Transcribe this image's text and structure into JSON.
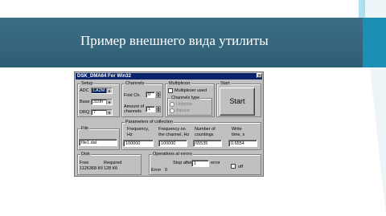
{
  "slide": {
    "title": "Пример внешнего вида утилиты"
  },
  "window": {
    "title": "DSK_DMA64 For Win32",
    "close_glyph": "×"
  },
  "setup": {
    "group_label": "Setup",
    "adc_label": "ADC",
    "adc_value": "LA2M",
    "base_label": "Base",
    "base_value": "310h",
    "drq_label": "DRQ",
    "drq_value": "7"
  },
  "channels": {
    "group_label": "Channels",
    "first_ch_label": "First Ch.",
    "first_ch_value": "0",
    "amount_label_1": "Amount of",
    "amount_label_2": "channels",
    "amount_value": "1"
  },
  "multiplexer": {
    "group_label": "Multiplexer",
    "used_label": "Multiplexer used",
    "channels_type_label": "Channels type",
    "option_1": "Unipolar",
    "option_2": "Bipolar"
  },
  "start": {
    "group_label": "Start",
    "button_label": "Start"
  },
  "file": {
    "group_label": "File",
    "value": "file1.dat"
  },
  "params": {
    "group_label": "Parameters of collection",
    "freq_label_1": "Frequency,",
    "freq_label_2": "Hz",
    "freq_value": "100000",
    "freq_ch_label_1": "Frequency on",
    "freq_ch_label_2": "the channel, Hz",
    "freq_ch_value": "100000",
    "counts_label_1": "Number of",
    "counts_label_2": "countings",
    "counts_value": "65535",
    "write_label_1": "Write",
    "write_label_2": "time, s",
    "write_value": "0.6554"
  },
  "disk": {
    "group_label": "Disk",
    "free_label": "Free",
    "required_label": "Required",
    "free_value": "1126368 Кб",
    "required_value": "128 Кб"
  },
  "errors": {
    "group_label": "Operations at errors",
    "stop_after_label": "Stop after",
    "stop_after_value": "1",
    "error_label": "error",
    "off_label": "off",
    "error_count_label": "Error",
    "error_count_value": "0"
  }
}
